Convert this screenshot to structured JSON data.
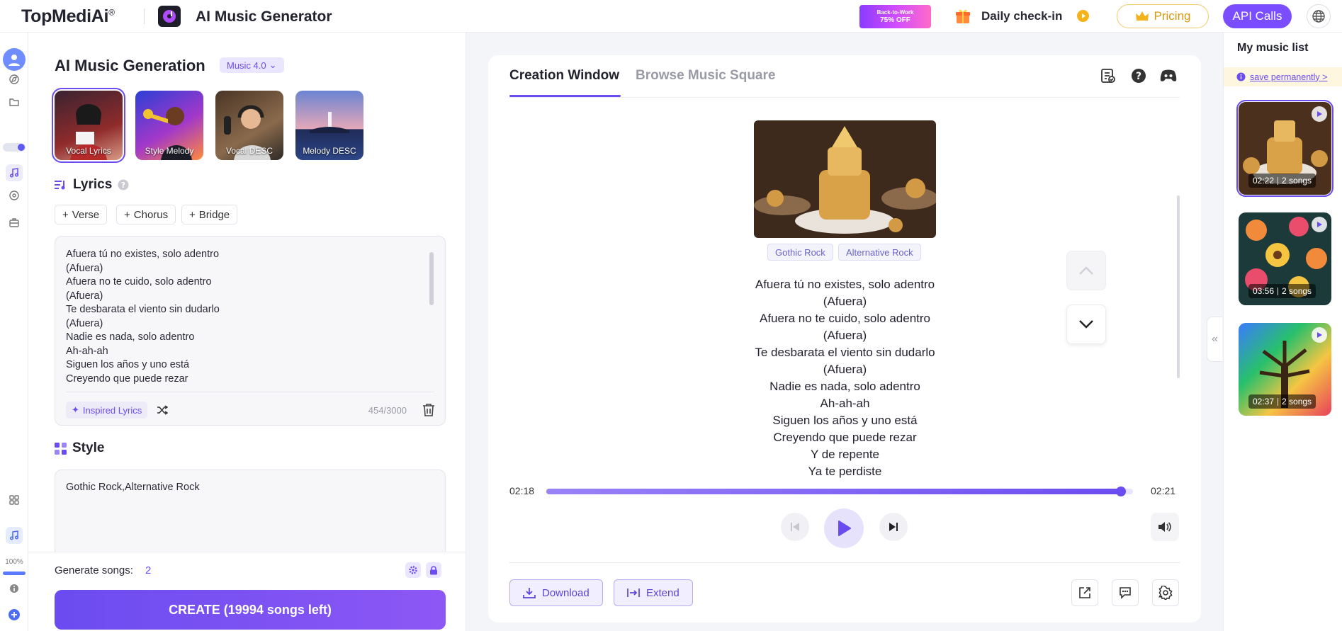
{
  "brand": {
    "name": "TopMediAi",
    "mark": "®"
  },
  "header": {
    "app_title": "AI Music Generator",
    "promo": {
      "line1": "Back-to-Work",
      "line2": "75% OFF"
    },
    "checkin_label": "Daily check-in",
    "pricing_label": "Pricing",
    "api_label": "API Calls"
  },
  "rail": {
    "zoom": "100%"
  },
  "form": {
    "title": "AI Music Generation",
    "model_version": "Music 4.0",
    "modes": [
      {
        "label": "Vocal Lyrics"
      },
      {
        "label": "Style Melody"
      },
      {
        "label": "Vocal DESC"
      },
      {
        "label": "Melody DESC"
      }
    ],
    "lyrics_title": "Lyrics",
    "chips": [
      {
        "label": "Verse"
      },
      {
        "label": "Chorus"
      },
      {
        "label": "Bridge"
      }
    ],
    "lyrics_lines": [
      "Afuera tú no existes, solo adentro",
      "(Afuera)",
      "Afuera no te cuido, solo adentro",
      "(Afuera)",
      "Te desbarata el viento sin dudarlo",
      "(Afuera)",
      "Nadie es nada, solo adentro",
      "Ah-ah-ah",
      "Siguen los años y uno está",
      "Creyendo que puede rezar"
    ],
    "inspired_label": "Inspired Lyrics",
    "lyrics_count": "454/3000",
    "style_title": "Style",
    "style_value": "Gothic Rock,Alternative Rock",
    "generate_label": "Generate songs:",
    "generate_value": "2",
    "create_label": "CREATE (19994 songs left)"
  },
  "main": {
    "tabs": [
      {
        "label": "Creation Window"
      },
      {
        "label": "Browse Music Square"
      }
    ],
    "tags": [
      "Gothic Rock",
      "Alternative Rock"
    ],
    "lyric_lines": [
      "Afuera tú no existes, solo adentro",
      "(Afuera)",
      "Afuera no te cuido, solo adentro",
      "(Afuera)",
      "Te desbarata el viento sin dudarlo",
      "(Afuera)",
      "Nadie es nada, solo adentro",
      "Ah-ah-ah",
      "Siguen los años y uno está",
      "Creyendo que puede rezar",
      "Y de repente",
      "Ya te perdiste"
    ],
    "player": {
      "current_time": "02:18",
      "total_time": "02:21",
      "progress": 0.98
    },
    "download_label": "Download",
    "extend_label": "Extend"
  },
  "music_list": {
    "title": "My music list",
    "save_label": "save permanently >",
    "items": [
      {
        "duration": "02:22",
        "songs": "2 songs"
      },
      {
        "duration": "03:56",
        "songs": "2 songs"
      },
      {
        "duration": "02:37",
        "songs": "2 songs"
      }
    ]
  },
  "colors": {
    "accent": "#6b4cf0",
    "pricing": "#d49a10"
  }
}
